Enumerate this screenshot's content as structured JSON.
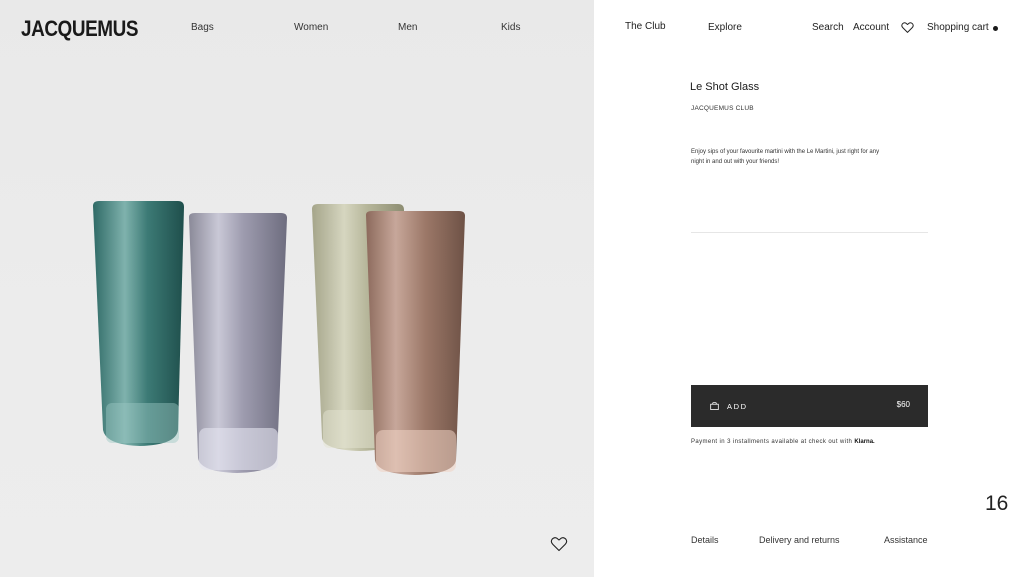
{
  "header": {
    "logo": "JACQUEMUS",
    "nav": [
      "Bags",
      "Women",
      "Men",
      "Kids"
    ],
    "secondary": [
      "The Club",
      "Explore"
    ],
    "search": "Search",
    "account": "Account",
    "cart": "Shopping cart"
  },
  "product": {
    "title": "Le Shot Glass",
    "brand": "JACQUEMUS CLUB",
    "description": "Enjoy sips of your favourite martini with the Le Martini, just right for any night in and out with your friends!",
    "add_label": "ADD",
    "price": "$60",
    "payment_note": "Payment in 3 installments available at check out with",
    "payment_provider": "Klarna."
  },
  "gallery": {
    "slide_count": "16"
  },
  "tabs": [
    "Details",
    "Delivery and returns",
    "Assistance"
  ],
  "colors": {
    "button_bg": "#2b2b2b",
    "image_bg": "#ebebeb"
  },
  "icons": [
    "heart-icon",
    "bag-icon"
  ]
}
